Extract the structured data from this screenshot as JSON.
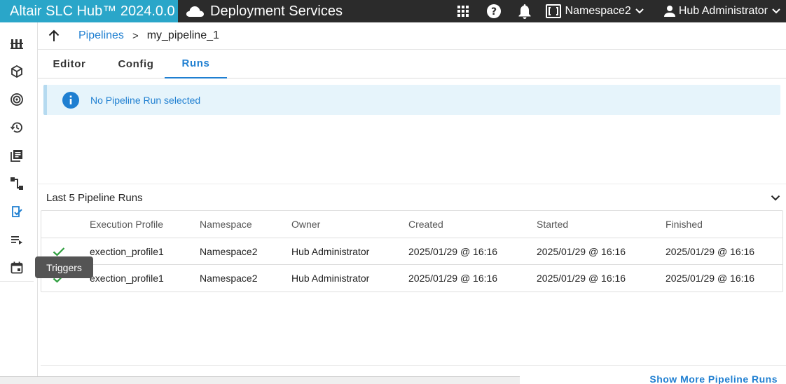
{
  "topbar": {
    "brand": "Altair SLC Hub™ 2024.0.0",
    "service": "Deployment Services",
    "namespace": "Namespace2",
    "user": "Hub Administrator",
    "icons": [
      "apps-grid-icon",
      "help-icon",
      "bell-icon",
      "namespace-icon",
      "person-icon"
    ]
  },
  "rail": {
    "items": [
      "dashboard-icon",
      "package-icon",
      "target-icon",
      "history-icon",
      "library-icon",
      "flow-icon",
      "pipeline-icon",
      "playlist-icon",
      "calendar-icon"
    ],
    "tooltip": "Triggers"
  },
  "breadcrumb": {
    "parent": "Pipelines",
    "separator": ">",
    "current": "my_pipeline_1"
  },
  "tabs": [
    {
      "label": "Editor",
      "active": false
    },
    {
      "label": "Config",
      "active": false
    },
    {
      "label": "Runs",
      "active": true
    }
  ],
  "alert": {
    "text": "No Pipeline Run selected"
  },
  "runs": {
    "title": "Last 5 Pipeline Runs",
    "columns": [
      "Execution Profile",
      "Namespace",
      "Owner",
      "Created",
      "Started",
      "Finished"
    ],
    "rows": [
      {
        "status": "success",
        "profile": "exection_profile1",
        "namespace": "Namespace2",
        "owner": "Hub Administrator",
        "created": "2025/01/29 @ 16:16",
        "started": "2025/01/29 @ 16:16",
        "finished": "2025/01/29 @ 16:16"
      },
      {
        "status": "success",
        "profile": "exection_profile1",
        "namespace": "Namespace2",
        "owner": "Hub Administrator",
        "created": "2025/01/29 @ 16:16",
        "started": "2025/01/29 @ 16:16",
        "finished": "2025/01/29 @ 16:16"
      }
    ],
    "show_more": "Show More Pipeline Runs"
  },
  "colors": {
    "brand": "#2aa6c9",
    "topbar": "#2b2b2b",
    "accent": "#1f7fd1",
    "success": "#2e9e3e",
    "alert_bg": "#e6f4fb"
  }
}
